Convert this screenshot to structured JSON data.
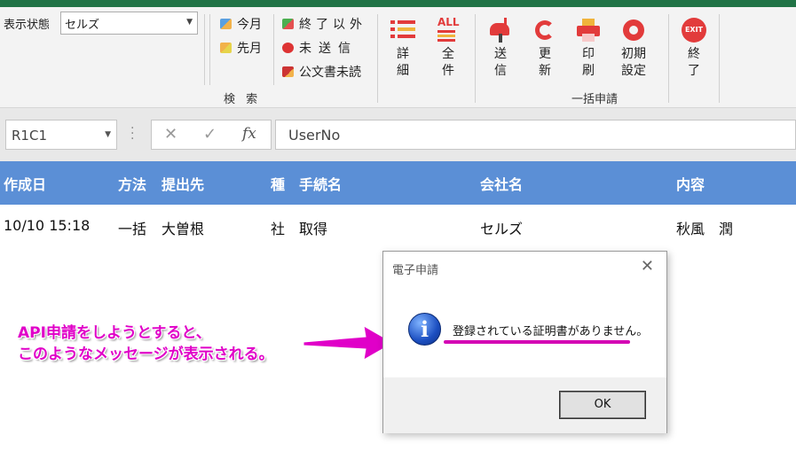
{
  "ribbon": {
    "status_label": "表示状態",
    "status_value": "セルズ",
    "search_group": {
      "items": [
        "今月",
        "先月"
      ],
      "label": "検 索"
    },
    "filter_items": [
      "終了以外",
      "未送信",
      "公文書未読"
    ],
    "detail_label": "詳細",
    "all_label": "全件",
    "all_icon_text": "ALL",
    "send_label": "送信",
    "update_label": "更新",
    "print_label": "印刷",
    "init_label": "初期設定",
    "bulk_group_label": "一括申請",
    "exit_label": "終了",
    "exit_icon_text": "EXIT"
  },
  "formula_bar": {
    "name_box": "R1C1",
    "formula": "UserNo"
  },
  "grid": {
    "headers": [
      "作成日",
      "方法",
      "提出先",
      "種",
      "手続名",
      "会社名",
      "内容"
    ],
    "rows": [
      [
        "10/10 15:18",
        "一括",
        "大曽根",
        "社",
        "取得",
        "セルズ",
        "秋風　潤"
      ]
    ]
  },
  "annotation": {
    "line1": "API申請をしようとすると、",
    "line2": "このようなメッセージが表示される。"
  },
  "dialog": {
    "title": "電子申請",
    "message": "登録されている証明書がありません。",
    "ok_label": "OK"
  },
  "colors": {
    "header_bg": "#5b8fd6",
    "annotation": "#e000c8",
    "title_bar": "#217346"
  }
}
